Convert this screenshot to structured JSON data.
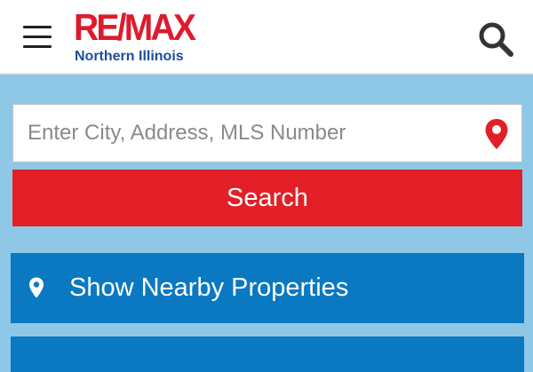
{
  "header": {
    "logo": {
      "brand": "RE/MAX",
      "region": "Northern Illinois"
    },
    "menu_icon": "hamburger-menu-icon",
    "search_icon": "search-icon"
  },
  "search": {
    "placeholder": "Enter City, Address, MLS Number",
    "value": "",
    "location_icon": "map-pin-icon",
    "button_label": "Search"
  },
  "actions": {
    "nearby_label": "Show Nearby Properties",
    "nearby_icon": "map-pin-icon"
  },
  "colors": {
    "brand_red": "#dc1c2e",
    "brand_blue": "#1b4f9c",
    "search_button": "#e21f26",
    "action_button": "#0a79c2",
    "page_background": "#8ec8e6"
  }
}
